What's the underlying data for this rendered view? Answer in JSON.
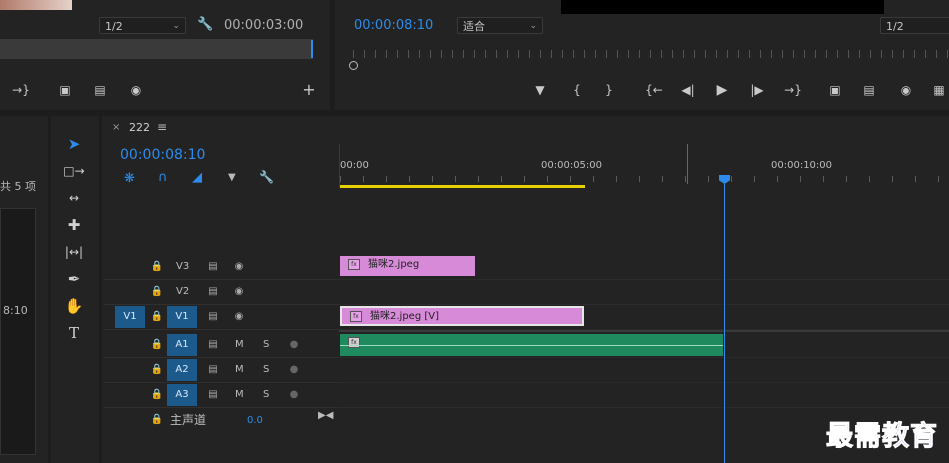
{
  "source_monitor": {
    "zoom": "1/2",
    "timecode": "00:00:03:00"
  },
  "program_monitor": {
    "timecode": "00:00:08:10",
    "fit": "适合",
    "zoom": "1/2"
  },
  "project_panel": {
    "count": "共 5 项",
    "item_time": "8:10"
  },
  "sequence": {
    "name": "222",
    "timecode": "00:00:08:10",
    "ruler": [
      "00:00",
      "00:00:05:00",
      "00:00:10:00"
    ]
  },
  "tracks": {
    "v3": "V3",
    "v2": "V2",
    "v1_src": "V1",
    "v1": "V1",
    "a1": "A1",
    "a2": "A2",
    "a3": "A3",
    "m": "M",
    "s": "S",
    "master": "主声道",
    "master_val": "0.0"
  },
  "clips": {
    "v3": "猫咪2.jpeg",
    "v1": "猫咪2.jpeg [V]"
  },
  "watermark": "最需教育",
  "colors": {
    "accent": "#2d8ceb",
    "video_clip": "#d68ad8",
    "audio_clip": "#1f8a5e",
    "work_area": "#e8d000"
  }
}
